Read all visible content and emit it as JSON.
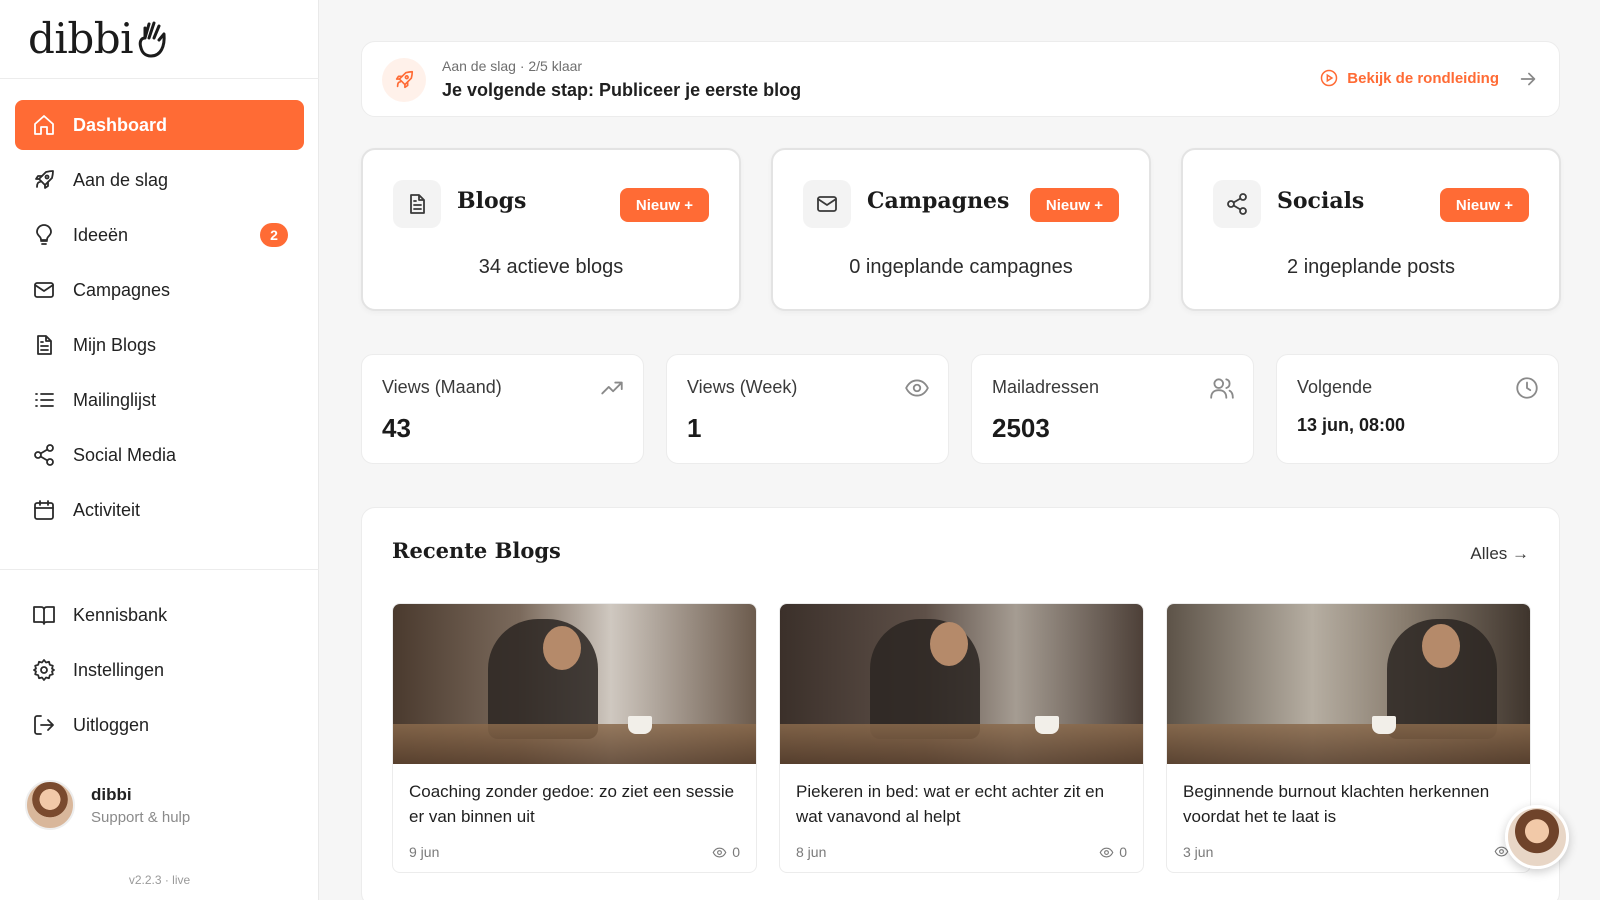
{
  "brand": {
    "name": "dibbi"
  },
  "sidebar": {
    "items": [
      {
        "label": "Dashboard",
        "icon": "home-icon",
        "active": true
      },
      {
        "label": "Aan de slag",
        "icon": "rocket-icon"
      },
      {
        "label": "Ideeën",
        "icon": "lightbulb-icon",
        "badge": "2"
      },
      {
        "label": "Campagnes",
        "icon": "mail-icon"
      },
      {
        "label": "Mijn Blogs",
        "icon": "document-icon"
      },
      {
        "label": "Mailinglijst",
        "icon": "list-icon"
      },
      {
        "label": "Social Media",
        "icon": "share-icon"
      },
      {
        "label": "Activiteit",
        "icon": "calendar-icon"
      }
    ],
    "bottom_items": [
      {
        "label": "Kennisbank",
        "icon": "book-icon"
      },
      {
        "label": "Instellingen",
        "icon": "gear-icon"
      },
      {
        "label": "Uitloggen",
        "icon": "logout-icon"
      }
    ],
    "profile": {
      "name": "dibbi",
      "subtitle": "Support & hulp"
    },
    "version": "v2.2.3 · live"
  },
  "banner": {
    "eyebrow": "Aan de slag · 2/5 klaar",
    "headline": "Je volgende stap: Publiceer je eerste blog",
    "tour_label": "Bekijk de rondleiding"
  },
  "cards": [
    {
      "title": "Blogs",
      "button": "Nieuw +",
      "subtitle": "34 actieve blogs",
      "icon": "document-icon"
    },
    {
      "title": "Campagnes",
      "button": "Nieuw +",
      "subtitle": "0 ingeplande campagnes",
      "icon": "mail-icon"
    },
    {
      "title": "Socials",
      "button": "Nieuw +",
      "subtitle": "2 ingeplande posts",
      "icon": "share-icon"
    }
  ],
  "stats": [
    {
      "label": "Views (Maand)",
      "value": "43",
      "icon": "trending-up-icon"
    },
    {
      "label": "Views (Week)",
      "value": "1",
      "icon": "eye-icon"
    },
    {
      "label": "Mailadressen",
      "value": "2503",
      "icon": "users-icon"
    },
    {
      "label": "Volgende",
      "value": "13 jun, 08:00",
      "icon": "clock-icon"
    }
  ],
  "recent": {
    "title": "Recente Blogs",
    "all_label": "Alles →",
    "blogs": [
      {
        "title": "Coaching zonder gedoe: zo ziet een sessie er van binnen uit",
        "date": "9 jun",
        "views": "0"
      },
      {
        "title": "Piekeren in bed: wat er echt achter zit en wat vanavond al helpt",
        "date": "8 jun",
        "views": "0"
      },
      {
        "title": "Beginnende burnout klachten herkennen voordat het te laat is",
        "date": "3 jun",
        "views": ""
      }
    ]
  },
  "colors": {
    "accent": "#ff6b35",
    "background": "#f6f6f6"
  }
}
